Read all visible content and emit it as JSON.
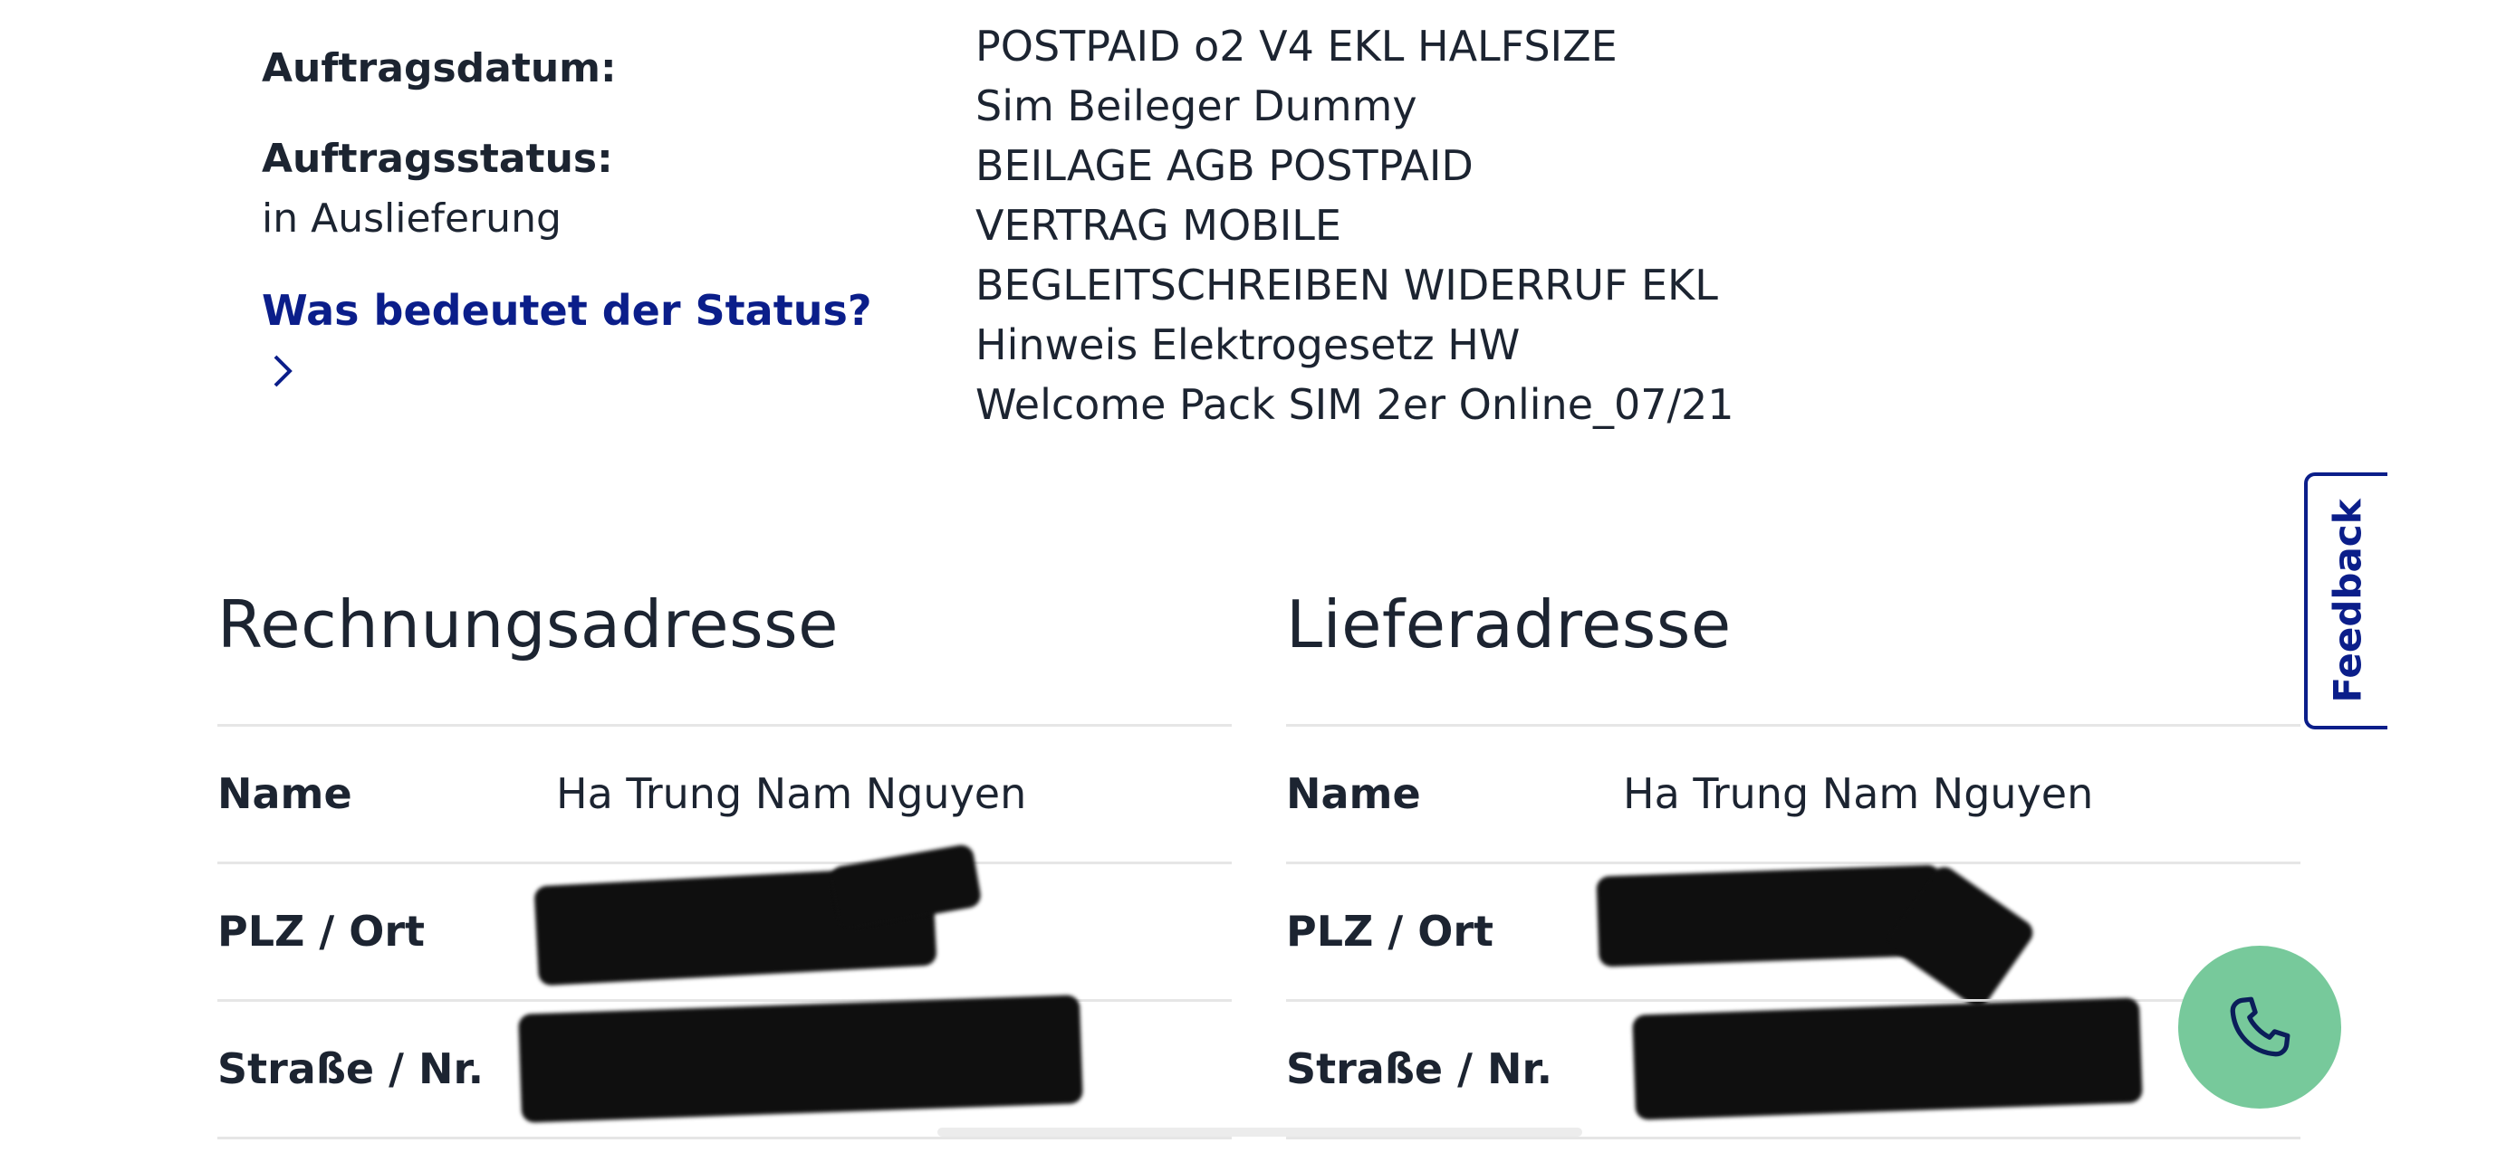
{
  "order": {
    "date_label": "Auftragsdatum:",
    "status_label": "Auftragsstatus:",
    "status_value": "in Auslieferung",
    "status_link": "Was bedeutet der Status?",
    "items": [
      "POSTPAID o2 V4 EKL HALFSIZE",
      "Sim Beileger Dummy",
      "BEILAGE AGB POSTPAID",
      "VERTRAG MOBILE",
      "BEGLEITSCHREIBEN WIDERRUF EKL",
      "Hinweis Elektrogesetz HW",
      "Welcome Pack SIM 2er Online_07/21"
    ]
  },
  "billing": {
    "title": "Rechnungsadresse",
    "name_label": "Name",
    "name_value": "Ha Trung Nam Nguyen",
    "city_label": "PLZ / Ort",
    "street_label": "Straße / Nr."
  },
  "delivery": {
    "title": "Lieferadresse",
    "name_label": "Name",
    "name_value": "Ha Trung Nam Nguyen",
    "city_label": "PLZ / Ort",
    "street_label": "Straße / Nr."
  },
  "feedback_label": "Feedback",
  "icons": {
    "status_chevron": "chevron-right-icon",
    "call": "phone-icon"
  },
  "colors": {
    "link": "#0b1e8a",
    "fab": "#77c99b",
    "text": "#1c2431"
  }
}
